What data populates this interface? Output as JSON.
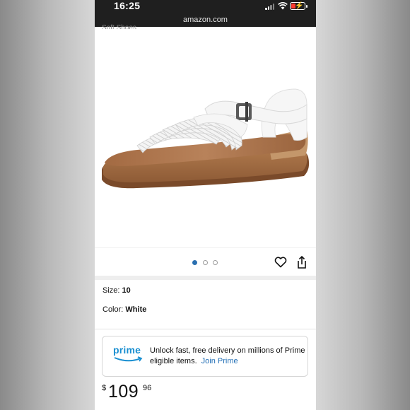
{
  "status_bar": {
    "time": "16:25",
    "url": "amazon.com"
  },
  "cut_off_text": "Soft Shoes",
  "product_image": {
    "alt": "White braided strap sandal with buckle"
  },
  "carousel": {
    "dots": 3,
    "active_index": 0
  },
  "details": {
    "size_label": "Size: ",
    "size_value": "10",
    "color_label": "Color: ",
    "color_value": "White"
  },
  "prime_banner": {
    "logo_text": "prime",
    "message": "Unlock fast, free delivery on millions of Prime eligible items.",
    "link_label": "Join Prime"
  },
  "price": {
    "currency": "$",
    "whole": "109",
    "fraction": "96"
  },
  "colors": {
    "prime_blue": "#1a8fd1",
    "link_blue": "#1f6db5",
    "dot_active": "#2a6fb0"
  }
}
